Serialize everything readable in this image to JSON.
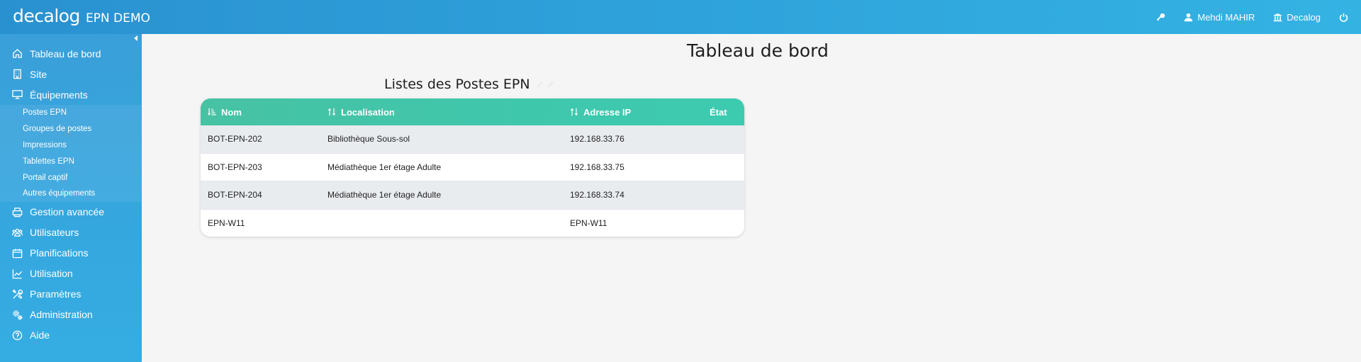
{
  "topbar": {
    "brand_logo": "decalog",
    "brand_title": "EPN DEMO",
    "user_name": "Mehdi MAHIR",
    "org_name": "Decalog"
  },
  "sidebar": {
    "items": [
      {
        "label": "Tableau de bord",
        "icon": "home-icon"
      },
      {
        "label": "Site",
        "icon": "building-icon"
      },
      {
        "label": "Équipements",
        "icon": "monitor-icon"
      },
      {
        "label": "Gestion avancée",
        "icon": "printer-icon"
      },
      {
        "label": "Utilisateurs",
        "icon": "users-icon"
      },
      {
        "label": "Planifications",
        "icon": "calendar-icon"
      },
      {
        "label": "Utilisation",
        "icon": "chart-icon"
      },
      {
        "label": "Paramètres",
        "icon": "tools-icon"
      },
      {
        "label": "Administration",
        "icon": "gears-icon"
      },
      {
        "label": "Aide",
        "icon": "help-icon"
      }
    ],
    "subitems": [
      {
        "label": "Postes EPN"
      },
      {
        "label": "Groupes de postes"
      },
      {
        "label": "Impressions"
      },
      {
        "label": "Tablettes EPN"
      },
      {
        "label": "Portail captif"
      },
      {
        "label": "Autres équipements"
      }
    ]
  },
  "main": {
    "page_title": "Tableau de bord",
    "list_title": "Listes des Postes EPN"
  },
  "table": {
    "columns": [
      "Nom",
      "Localisation",
      "Adresse IP",
      "État"
    ],
    "rows": [
      [
        "BOT-EPN-202",
        "Bibliothèque Sous-sol",
        "192.168.33.76",
        ""
      ],
      [
        "BOT-EPN-203",
        "Médiathèque 1er étage Adulte",
        "192.168.33.75",
        ""
      ],
      [
        "BOT-EPN-204",
        "Médiathèque 1er étage Adulte",
        "192.168.33.74",
        ""
      ],
      [
        "EPN-W11",
        "",
        "EPN-W11",
        ""
      ]
    ]
  },
  "colors": {
    "header_blue": "#2ea2db",
    "table_header_green": "#45c4a6"
  }
}
